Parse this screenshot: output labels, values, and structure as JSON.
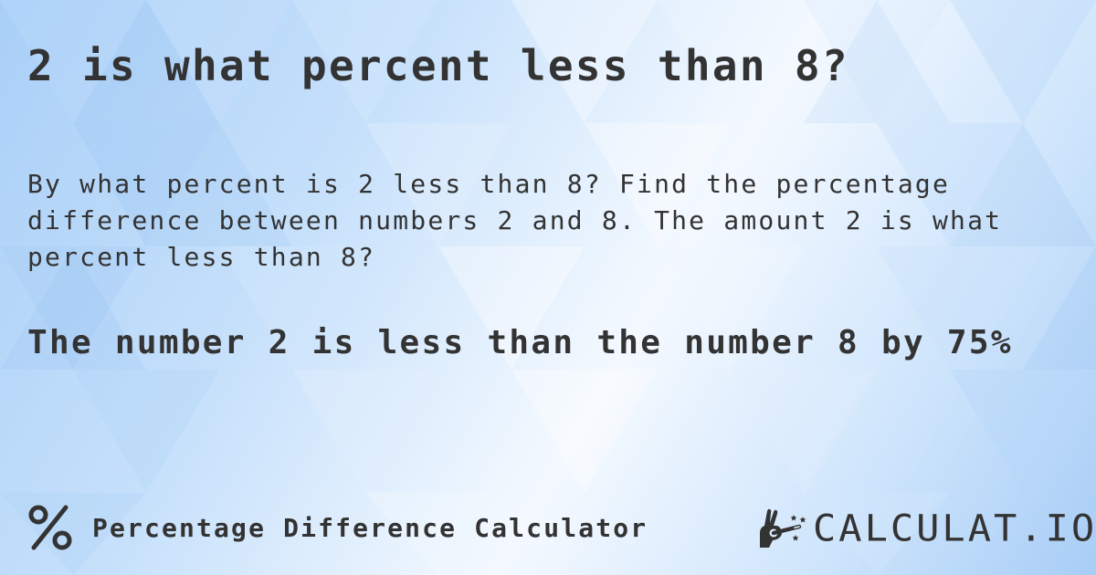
{
  "page": {
    "title": "2 is what percent less than 8?",
    "description": "By what percent is 2 less than 8? Find the percentage difference between numbers 2 and 8. The amount 2 is what percent less than 8?",
    "result": "The number 2 is less than the number 8 by 75%"
  },
  "footer": {
    "calculator_icon": "percent-icon",
    "calculator_name": "Percentage Difference Calculator",
    "logo_icon": "hand-magic-wand-icon",
    "logo_text": "CALCULAT.IO"
  },
  "theme": {
    "text_color": "#333333",
    "background_light": "#f4f9ff",
    "background_blue": "#a9cff7"
  }
}
